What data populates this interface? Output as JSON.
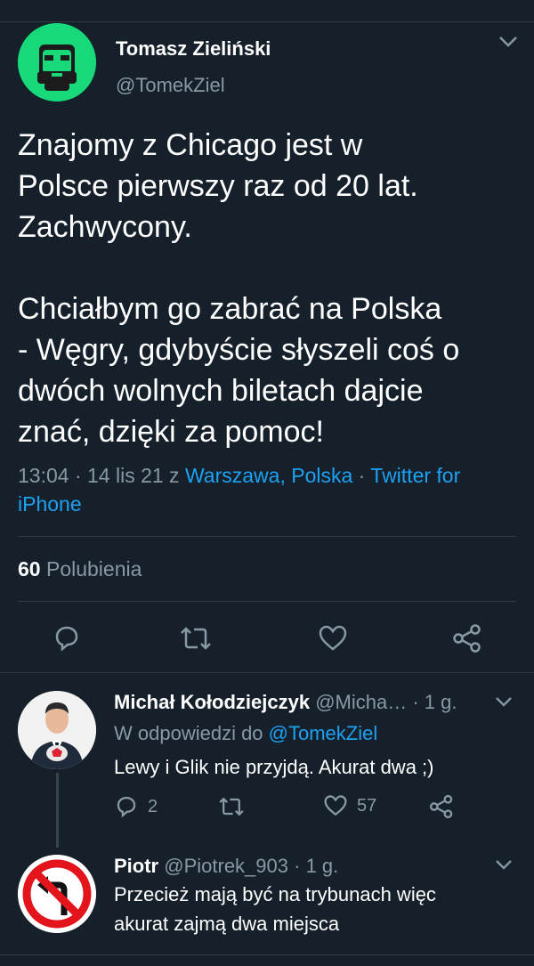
{
  "tweet": {
    "author_name": "Tomasz Zieliński",
    "author_handle": "@TomekZiel",
    "text": "Znajomy z Chicago jest w\nPolsce pierwszy raz od 20 lat.\nZachwycony.\n\nChciałbym go zabrać na Polska\n- Węgry, gdybyście słyszeli coś o\ndwóch wolnych biletach dajcie\nznać, dzięki za pomoc!",
    "time": "13:04 · 14 lis 21 z ",
    "location": "Warszawa, Polska",
    "sep": " · ",
    "client": "Twitter for iPhone",
    "likes_count": "60",
    "likes_label": "Polubienia"
  },
  "replies": [
    {
      "name": "Michał Kołodziejczyk",
      "handle": "@Micha…",
      "time": "· 1 g.",
      "reply_to_label": "W odpowiedzi do ",
      "reply_to_handle": "@TomekZiel",
      "text": "Lewy i Glik nie przyjdą. Akurat dwa ;)",
      "reply_count": "2",
      "like_count": "57"
    },
    {
      "name": "Piotr",
      "handle": "@Piotrek_903",
      "time": "· 1 g.",
      "text": "Przecież mają być na trybunach więc\nakurat zajmą dwa miejsca"
    }
  ],
  "colors": {
    "background": "#15202b",
    "secondary_text": "#8899a6",
    "link": "#1da1f2",
    "divider": "#2f3b47",
    "avatar_green": "#17d97a"
  },
  "icons": [
    "chevron-down-icon",
    "reply-icon",
    "retweet-icon",
    "like-icon",
    "share-icon",
    "no-left-turn-sign-icon"
  ]
}
